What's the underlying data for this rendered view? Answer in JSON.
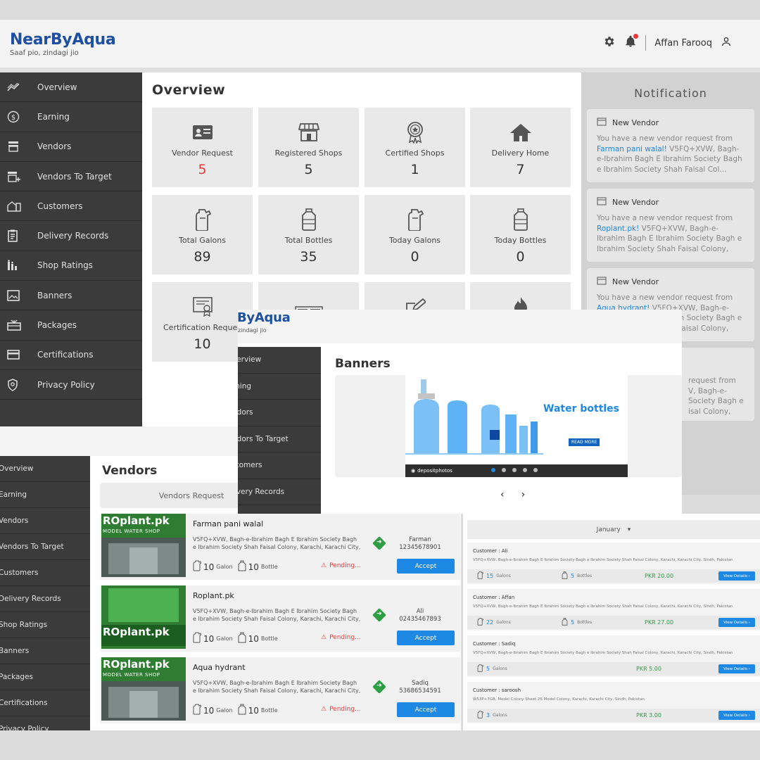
{
  "app": {
    "brand": "NearByAqua",
    "tagline": "Saaf pio, zindagi jio",
    "user": "Affan Farooq",
    "brand_partial": "ByAqua",
    "tagline_partial": "zindagi jio"
  },
  "sidebar": {
    "items": [
      {
        "label": "Overview",
        "icon": "chart-line-icon"
      },
      {
        "label": "Earning",
        "icon": "dollar-circle-icon"
      },
      {
        "label": "Vendors",
        "icon": "store-icon"
      },
      {
        "label": "Vendors To Target",
        "icon": "store-add-icon"
      },
      {
        "label": "Customers",
        "icon": "building-icon"
      },
      {
        "label": "Delivery Records",
        "icon": "document-icon"
      },
      {
        "label": "Shop Ratings",
        "icon": "ratings-icon"
      },
      {
        "label": "Banners",
        "icon": "image-icon"
      },
      {
        "label": "Packages",
        "icon": "package-icon"
      },
      {
        "label": "Certifications",
        "icon": "credit-card-icon"
      },
      {
        "label": "Privacy Policy",
        "icon": "shield-icon"
      }
    ]
  },
  "sidebar_b": {
    "items": [
      "verview",
      "rning",
      "ndors",
      "ndors To Target",
      "stomers",
      "livery Records"
    ]
  },
  "sidebar_c": {
    "items": [
      "Overview",
      "Earning",
      "Vendors",
      "Vendors To Target",
      "Customers",
      "Delivery Records",
      "Shop Ratings",
      "Banners",
      "Packages",
      "Certifications",
      "Privacy Policy"
    ]
  },
  "overview": {
    "title": "Overview",
    "cards": [
      {
        "label": "Vendor Request",
        "value": "5",
        "icon": "id-card-icon"
      },
      {
        "label": "Registered Shops",
        "value": "5",
        "icon": "shop-icon"
      },
      {
        "label": "Certified Shops",
        "value": "1",
        "icon": "award-icon"
      },
      {
        "label": "Delivery Home",
        "value": "7",
        "icon": "home-icon"
      },
      {
        "label": "Total Galons",
        "value": "89",
        "icon": "gallon-icon"
      },
      {
        "label": "Total Bottles",
        "value": "35",
        "icon": "bottle-icon"
      },
      {
        "label": "Today Galons",
        "value": "0",
        "icon": "gallon-icon"
      },
      {
        "label": "Today Bottles",
        "value": "0",
        "icon": "bottle-icon"
      },
      {
        "label": "Certification Reques",
        "value": "10",
        "icon": "certificate-icon"
      },
      {
        "label": "",
        "value": "",
        "icon": "ad-icon"
      },
      {
        "label": "",
        "value": "",
        "icon": "edit-icon"
      },
      {
        "label": "",
        "value": "",
        "icon": "fire-discount-icon"
      }
    ]
  },
  "notifications": {
    "title": "Notification",
    "items": [
      {
        "title": "New Vendor",
        "prefix": "You have a new vendor request from",
        "link": "Farman pani walal!",
        "address": " V5FQ+XVW, Bagh-e-Ibrahim Bagh E Ibrahim Society Bagh e Ibrahim Society Shah Faisal Col..."
      },
      {
        "title": "New Vendor",
        "prefix": "You have a new vendor request from",
        "link": "Roplant.pk!",
        "address": " V5FQ+XVW, Bagh-e-Ibrahim Bagh E Ibrahim Society Bagh e Ibrahim Society Shah Faisal Colony, Ka..."
      },
      {
        "title": "New Vendor",
        "prefix": "You have a new vendor request from",
        "link": "Aqua hydrant!",
        "address": " V5FQ+XVW, Bagh-e-Ibrahim Bagh E Ibrahim Society Bagh e Ibrahim Society Shah Faisal Colony, Ka..."
      },
      {
        "title": "",
        "prefix": "",
        "link": "",
        "address": "request from V, Bagh-e- Society Bagh e isal Colony, Ka..."
      }
    ]
  },
  "banners": {
    "title": "Banners",
    "headline": "Water bottles",
    "cta": "READ MORE",
    "watermark": "depositphotos",
    "prev": "‹",
    "next": "›"
  },
  "vendors": {
    "title": "Vendors",
    "tab": "Vendors Request",
    "items": [
      {
        "name": "Farman pani walal",
        "address": "V5FQ+XVW, Bagh-e-Ibrahim Bagh E Ibrahim Society Bagh e Ibrahim Society Shah Faisal Colony, Karachi, Karachi City,",
        "galons": "10",
        "galon_unit": "Galon",
        "bottles": "10",
        "bottle_unit": "Bottle",
        "status": "Pending...",
        "owner": "Farman",
        "phone": "12345678901",
        "action": "Accept",
        "sign": "ROplant.pk",
        "sign_sub": "MODEL WATER SHOP"
      },
      {
        "name": "Roplant.pk",
        "address": "V5FQ+XVW, Bagh-e-Ibrahim Bagh E Ibrahim Society Bagh e Ibrahim Society Shah Faisal Colony, Karachi, Karachi City,",
        "galons": "10",
        "galon_unit": "Galon",
        "bottles": "10",
        "bottle_unit": "Bottle",
        "status": "Pending...",
        "owner": "Ali",
        "phone": "02435467893",
        "action": "Accept",
        "sign": "ROplant.pk",
        "sign_sub": ""
      },
      {
        "name": "Aqua hydrant",
        "address": "V5FQ+XVW, Bagh-e-Ibrahim Bagh E Ibrahim Society Bagh e Ibrahim Society Shah Faisal Colony, Karachi, Karachi City,",
        "galons": "10",
        "galon_unit": "Galon",
        "bottles": "10",
        "bottle_unit": "Bottle",
        "status": "Pending...",
        "owner": "Sadiq",
        "phone": "53686534591",
        "action": "Accept",
        "sign": "ROplant.pk",
        "sign_sub": "MODEL WATER SHOP"
      }
    ]
  },
  "delivery": {
    "month": "January",
    "records": [
      {
        "customer": "Customer : Ali",
        "address": "V5FQ+XVW, Bagh-e-Ibrahim Bagh E Ibrahim Society Bagh e Ibrahim Society Shah Faisal Colony, Karachi, Karachi City, Sindh, Pakistan",
        "galons": "15",
        "galon_unit": "Galons",
        "bottles": "5",
        "bottle_unit": "Bottles",
        "price": "PKR 20.00",
        "action": "View Details"
      },
      {
        "customer": "Customer : Affan",
        "address": "V5FQ+XVW, Bagh-e-Ibrahim Bagh E Ibrahim Society Bagh e Ibrahim Society Shah Faisal Colony, Karachi, Karachi City, Sindh, Pakistan",
        "galons": "22",
        "galon_unit": "Galons",
        "bottles": "5",
        "bottle_unit": "Bottles",
        "price": "PKR 27.00",
        "action": "View Details"
      },
      {
        "customer": "Customer : Sadiq",
        "address": "V5FQ+XVW, Bagh-e-Ibrahim Bagh E Ibrahim Society Bagh e Ibrahim Society Shah Faisal Colony, Karachi, Karachi City, Sindh, Pakistan",
        "galons": "5",
        "galon_unit": "Galons",
        "bottles": "",
        "bottle_unit": "",
        "price": "PKR 5.00",
        "action": "View Details"
      },
      {
        "customer": "Customer : saroosh",
        "address": "W53P+7GB, Model Colony Sheet 26 Model Colony, Karachi, Karachi City, Sindh, Pakistan",
        "galons": "3",
        "galon_unit": "Galons",
        "bottles": "",
        "bottle_unit": "",
        "price": "PKR 3.00",
        "action": "View Details"
      }
    ]
  },
  "colors": {
    "brand": "#1f4fa0",
    "sidebar": "#3b3b3b",
    "accent": "#1e88e5",
    "danger": "#e53935",
    "success": "#2e9e44"
  }
}
